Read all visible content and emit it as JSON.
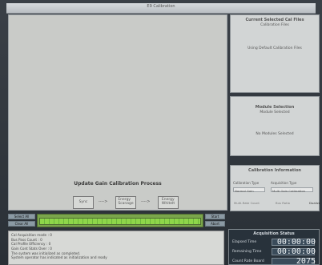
{
  "titlebar": {
    "title": "E9 Calibration"
  },
  "canvas": {
    "process_title": "Update Gain Calibration Process",
    "flow": [
      {
        "label": "Sync"
      },
      {
        "label": "Energy\nScanage"
      },
      {
        "label": "Energy\nWhiteIt"
      }
    ],
    "arrows": [
      "---->",
      "---->"
    ]
  },
  "panels": {
    "current_selected_cal_files": {
      "title": "Current Selected Cal Files",
      "subtitle": "Calibration Files",
      "message": "Using Default Calibration Files"
    },
    "module_selection": {
      "title": "Module Selection",
      "subtitle": "Module Selected",
      "message": "No Modules Selected"
    },
    "calibration_information": {
      "title": "Calibration Information",
      "calibration_type_label": "Calibration Type",
      "acquisition_type_label": "Acquisition Type",
      "calibration_type_value": "Normal Gain",
      "acquisition_type_value": "Multi Gain Calibration",
      "option_left": "Multi-Rate Count",
      "option_right": "Bus Ratio",
      "side_option": "Dualize"
    }
  },
  "bottom": {
    "buttons_left": [
      "Select All",
      "Clear All"
    ],
    "buttons_right": [
      "Start",
      "Abort"
    ],
    "log_lines": [
      "Cal Acquisition mode : 0",
      "Bus Pass Count : 0",
      "Cal Profile Efficiency : 0",
      "Gain Cont Stats Over : 0",
      "",
      "The system was initialized as completed.",
      "System operator has indicated as initialization and ready"
    ]
  },
  "status": {
    "title": "Acquisition Status",
    "elapsed_label": "Elapsed Time",
    "elapsed_value": "00:00:00",
    "remaining_label": "Remaining Time",
    "remaining_value": "00:00:00",
    "count_label": "Count Rate Board",
    "count_value": "2075"
  }
}
